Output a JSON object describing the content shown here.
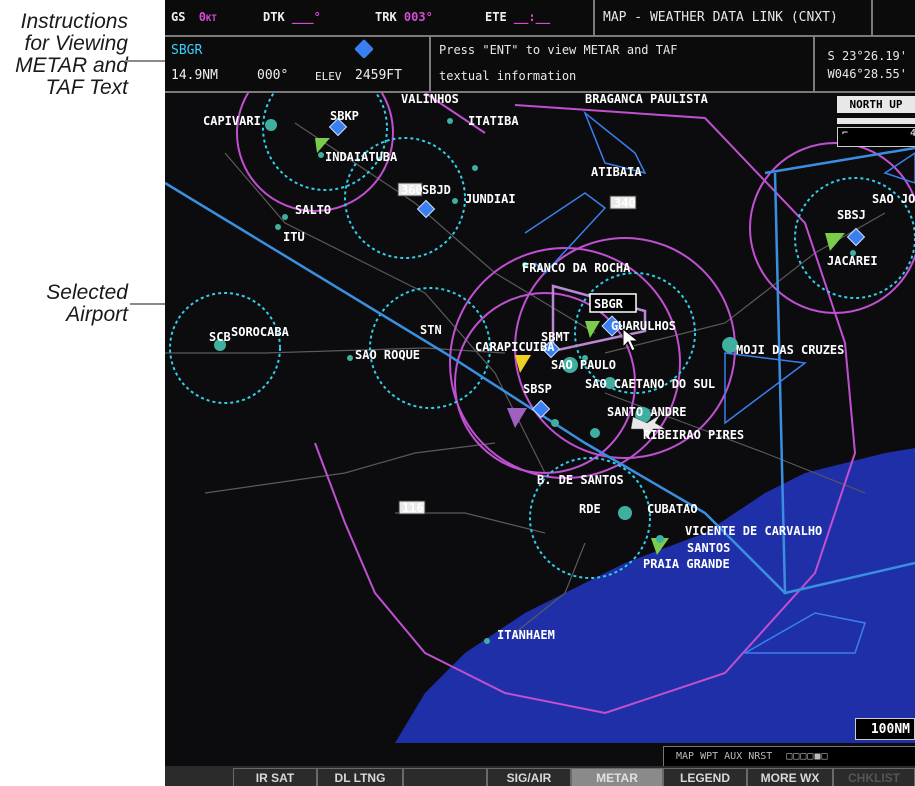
{
  "callouts": {
    "instructions": [
      "Instructions",
      "for Viewing",
      "METAR and",
      "TAF Text"
    ],
    "selected": [
      "Selected",
      "Airport"
    ]
  },
  "topbar": {
    "gs_label": "GS",
    "gs_value": "0",
    "gs_unit": "KT",
    "dtk_label": "DTK",
    "dtk_value": "___°",
    "trk_label": "TRK",
    "trk_value": "003°",
    "ete_label": "ETE",
    "ete_value": "__:__",
    "page_title": "MAP - WEATHER DATA LINK (CNXT)"
  },
  "waypoint_bar": {
    "ident": "SBGR",
    "distance": "14.9NM",
    "bearing": "000°",
    "elev_label": "ELEV",
    "elev_value": "2459FT",
    "instruction_line1": "Press \"ENT\" to view METAR and TAF",
    "instruction_line2": "textual information",
    "lat": "S 23°26.19'",
    "lon": "W046°28.55'"
  },
  "map": {
    "orientation": "NORTH UP",
    "scale_label": "4",
    "range": "100NM",
    "page_group": "MAP WPT AUX NRST",
    "selected_airport": "SBGR",
    "labels": {
      "valinhos": "VALINHOS",
      "braganca": "BRAGANCA PAULISTA",
      "capivari": "CAPIVARI",
      "sbkp": "SBKP",
      "itatiba": "ITATIBA",
      "indaiatuba": "INDAIATUBA",
      "atibaia": "ATIBAIA",
      "sbjd": "SBJD",
      "jundiai": "JUNDIAI",
      "salto": "SALTO",
      "itu": "ITU",
      "sao_jose": "SAO JOS",
      "sbsj": "SBSJ",
      "jacarei": "JACAREI",
      "franco": "FRANCO DA ROCHA",
      "sorocaba": "SOROCABA",
      "scb": "SCB",
      "stn": "STN",
      "sao_roque": "SAO ROQUE",
      "sbmt": "SBMT",
      "carapicuiba": "CARAPICUIBA",
      "guarulhos": "GUARULHOS",
      "moji": "MOJI DAS CRUZES",
      "sao_paulo": "SAO PAULO",
      "sbsp": "SBSP",
      "sao_caetano": "SAO CAETANO DO SUL",
      "santo_andre": "SANTO ANDRE",
      "ribeirao": "RIBEIRAO PIRES",
      "b_de_santos": "B. DE SANTOS",
      "rde": "RDE",
      "cubatao": "CUBATAO",
      "vicente": "VICENTE DE CARVALHO",
      "santos": "SANTOS",
      "praia_grande": "PRAIA GRANDE",
      "itanhaem": "ITANHAEM",
      "hw_360": "360",
      "hw_340": "340",
      "hw_116": "116"
    }
  },
  "softkeys": [
    "IR SAT",
    "DL LTNG",
    "SIG/AIR",
    "METAR",
    "LEGEND",
    "MORE WX",
    "CHKLIST"
  ],
  "colors": {
    "magenta": "#c050d0",
    "cyan": "#2fd0e8",
    "airway": "#3a8fe0",
    "ocean": "#1e2fa8"
  }
}
